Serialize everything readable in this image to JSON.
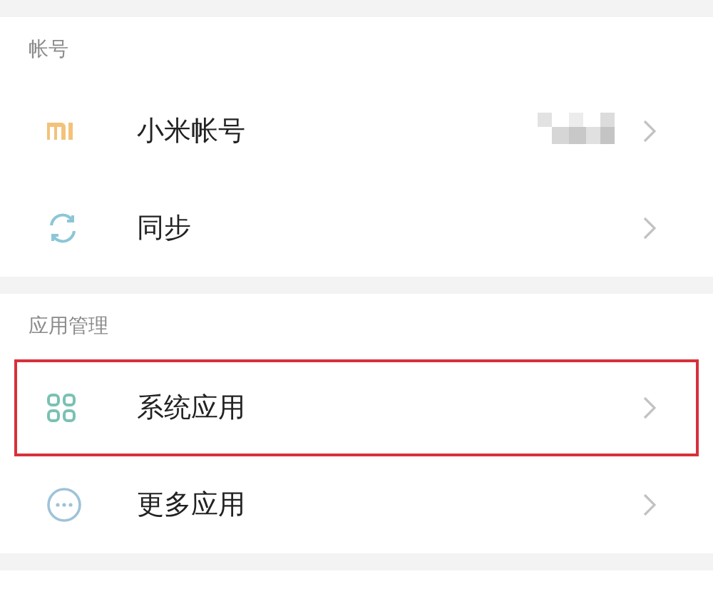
{
  "sections": [
    {
      "title": "帐号",
      "items": [
        {
          "kind": "logo",
          "label": "小米帐号",
          "masked_value": true,
          "highlighted": false
        },
        {
          "kind": "sync",
          "label": "同步",
          "masked_value": false,
          "highlighted": false
        }
      ]
    },
    {
      "title": "应用管理",
      "items": [
        {
          "kind": "grid",
          "label": "系统应用",
          "masked_value": false,
          "highlighted": true
        },
        {
          "kind": "more",
          "label": "更多应用",
          "masked_value": false,
          "highlighted": false
        }
      ]
    }
  ]
}
